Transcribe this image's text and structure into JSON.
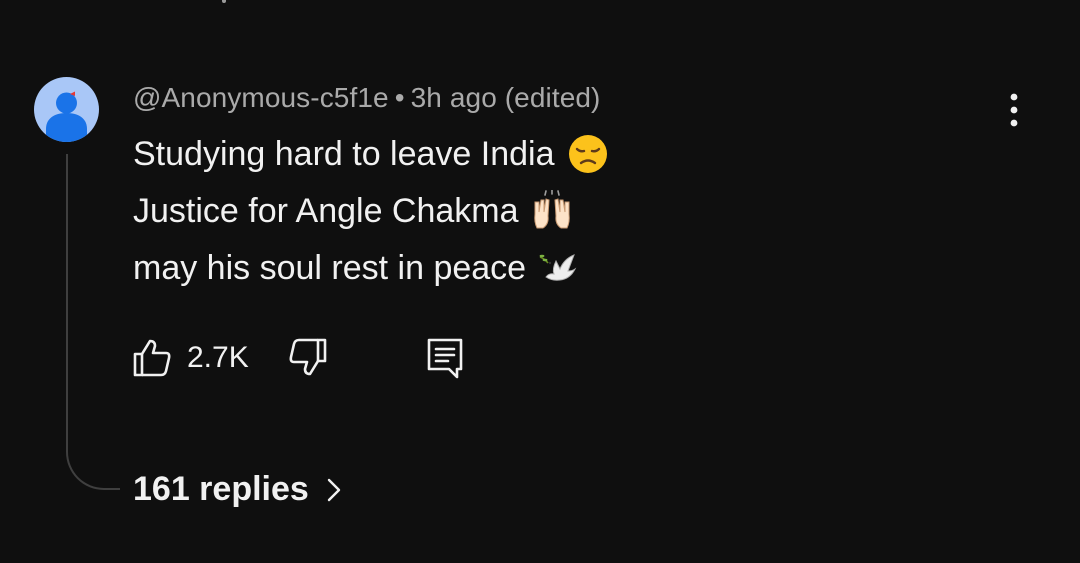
{
  "comment": {
    "author": "@Anonymous-c5f1e",
    "separator": "•",
    "time": "3h ago (edited)",
    "lines": [
      {
        "text": "Studying hard to leave India",
        "emoji": "disappointed-face-icon"
      },
      {
        "text": "Justice for Angle Chakma",
        "emoji": "raising-hands-icon"
      },
      {
        "text": "may his soul rest in peace",
        "emoji": "dove-icon"
      }
    ],
    "likes": "2.7K",
    "replies_label": "161 replies"
  },
  "colors": {
    "background": "#0f0f0f",
    "text": "#f1f1f1",
    "meta": "#aaaaaa",
    "avatar_bg": "#a9c7f7",
    "avatar_figure": "#1a73e8",
    "thread_line": "#3f3f3f"
  }
}
